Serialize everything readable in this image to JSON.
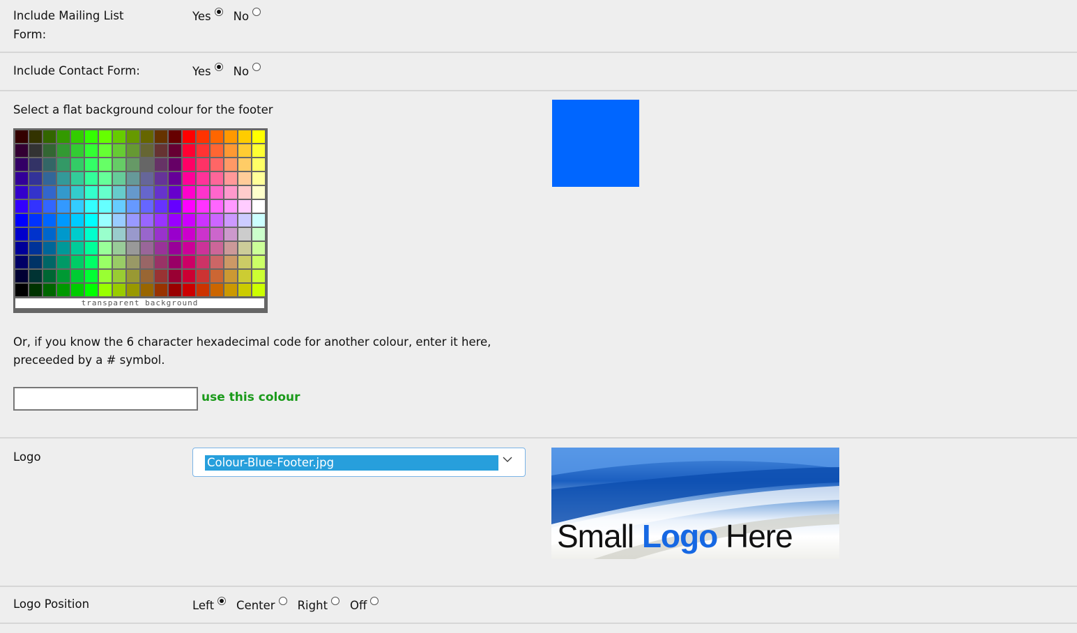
{
  "mailing_list": {
    "label": "Include Mailing List Form:",
    "options": [
      {
        "label": "Yes",
        "checked": true
      },
      {
        "label": "No",
        "checked": false
      }
    ]
  },
  "contact_form": {
    "label": "Include Contact Form:",
    "options": [
      {
        "label": "Yes",
        "checked": true
      },
      {
        "label": "No",
        "checked": false
      }
    ]
  },
  "footer_colour": {
    "label": "Select a flat background colour for the footer",
    "transparent_label": "transparent background",
    "selected_colour": "#0066FF",
    "palette": [
      [
        "#330000",
        "#333300",
        "#336600",
        "#339900",
        "#33CC00",
        "#33FF00",
        "#66FF00",
        "#66CC00",
        "#669900",
        "#666600",
        "#663300",
        "#660000",
        "#FF0000",
        "#FF3300",
        "#FF6600",
        "#FF9900",
        "#FFCC00",
        "#FFFF00"
      ],
      [
        "#330033",
        "#333333",
        "#336633",
        "#339933",
        "#33CC33",
        "#33FF33",
        "#66FF33",
        "#66CC33",
        "#669933",
        "#666633",
        "#663333",
        "#660033",
        "#FF0033",
        "#FF3333",
        "#FF6633",
        "#FF9933",
        "#FFCC33",
        "#FFFF33"
      ],
      [
        "#330066",
        "#333366",
        "#336666",
        "#339966",
        "#33CC66",
        "#33FF66",
        "#66FF66",
        "#66CC66",
        "#669966",
        "#666666",
        "#663366",
        "#660066",
        "#FF0066",
        "#FF3366",
        "#FF6666",
        "#FF9966",
        "#FFCC66",
        "#FFFF66"
      ],
      [
        "#330099",
        "#333399",
        "#336699",
        "#339999",
        "#33CC99",
        "#33FF99",
        "#66FF99",
        "#66CC99",
        "#669999",
        "#666699",
        "#663399",
        "#660099",
        "#FF0099",
        "#FF3399",
        "#FF6699",
        "#FF9999",
        "#FFCC99",
        "#FFFF99"
      ],
      [
        "#3300CC",
        "#3333CC",
        "#3366CC",
        "#3399CC",
        "#33CCCC",
        "#33FFCC",
        "#66FFCC",
        "#66CCCC",
        "#6699CC",
        "#6666CC",
        "#6633CC",
        "#6600CC",
        "#FF00CC",
        "#FF33CC",
        "#FF66CC",
        "#FF99CC",
        "#FFCCCC",
        "#FFFFCC"
      ],
      [
        "#3300FF",
        "#3333FF",
        "#3366FF",
        "#3399FF",
        "#33CCFF",
        "#33FFFF",
        "#66FFFF",
        "#66CCFF",
        "#6699FF",
        "#6666FF",
        "#6633FF",
        "#6600FF",
        "#FF00FF",
        "#FF33FF",
        "#FF66FF",
        "#FF99FF",
        "#FFCCFF",
        "#FFFFFF"
      ],
      [
        "#0000FF",
        "#0033FF",
        "#0066FF",
        "#0099FF",
        "#00CCFF",
        "#00FFFF",
        "#99FFFF",
        "#99CCFF",
        "#9999FF",
        "#9966FF",
        "#9933FF",
        "#9900FF",
        "#CC00FF",
        "#CC33FF",
        "#CC66FF",
        "#CC99FF",
        "#CCCCFF",
        "#CCFFFF"
      ],
      [
        "#0000CC",
        "#0033CC",
        "#0066CC",
        "#0099CC",
        "#00CCCC",
        "#00FFCC",
        "#99FFCC",
        "#99CCCC",
        "#9999CC",
        "#9966CC",
        "#9933CC",
        "#9900CC",
        "#CC00CC",
        "#CC33CC",
        "#CC66CC",
        "#CC99CC",
        "#CCCCCC",
        "#CCFFCC"
      ],
      [
        "#000099",
        "#003399",
        "#006699",
        "#009999",
        "#00CC99",
        "#00FF99",
        "#99FF99",
        "#99CC99",
        "#999999",
        "#996699",
        "#993399",
        "#990099",
        "#CC0099",
        "#CC3399",
        "#CC6699",
        "#CC9999",
        "#CCCC99",
        "#CCFF99"
      ],
      [
        "#000066",
        "#003366",
        "#006666",
        "#009966",
        "#00CC66",
        "#00FF66",
        "#99FF66",
        "#99CC66",
        "#999966",
        "#996666",
        "#993366",
        "#990066",
        "#CC0066",
        "#CC3366",
        "#CC6666",
        "#CC9966",
        "#CCCC66",
        "#CCFF66"
      ],
      [
        "#000033",
        "#003333",
        "#006633",
        "#009933",
        "#00CC33",
        "#00FF33",
        "#99FF33",
        "#99CC33",
        "#999933",
        "#996633",
        "#993333",
        "#990033",
        "#CC0033",
        "#CC3333",
        "#CC6633",
        "#CC9933",
        "#CCCC33",
        "#CCFF33"
      ],
      [
        "#000000",
        "#003300",
        "#006600",
        "#009900",
        "#00CC00",
        "#00FF00",
        "#99FF00",
        "#99CC00",
        "#999900",
        "#996600",
        "#993300",
        "#990000",
        "#CC0000",
        "#CC3300",
        "#CC6600",
        "#CC9900",
        "#CCCC00",
        "#CCFF00"
      ]
    ],
    "hex_instructions": "Or, if you know the 6 character hexadecimal code for another colour, enter it here, preceeded by a # symbol.",
    "hex_input_value": "",
    "use_colour_label": "use this colour"
  },
  "logo": {
    "label": "Logo",
    "selected_file": "Colour-Blue-Footer.jpg",
    "preview_text": {
      "part1": "Small ",
      "part2": "Logo",
      "part3": " Here"
    }
  },
  "logo_position": {
    "label": "Logo Position",
    "options": [
      {
        "label": "Left",
        "checked": true
      },
      {
        "label": "Center",
        "checked": false
      },
      {
        "label": "Right",
        "checked": false
      },
      {
        "label": "Off",
        "checked": false
      }
    ]
  }
}
